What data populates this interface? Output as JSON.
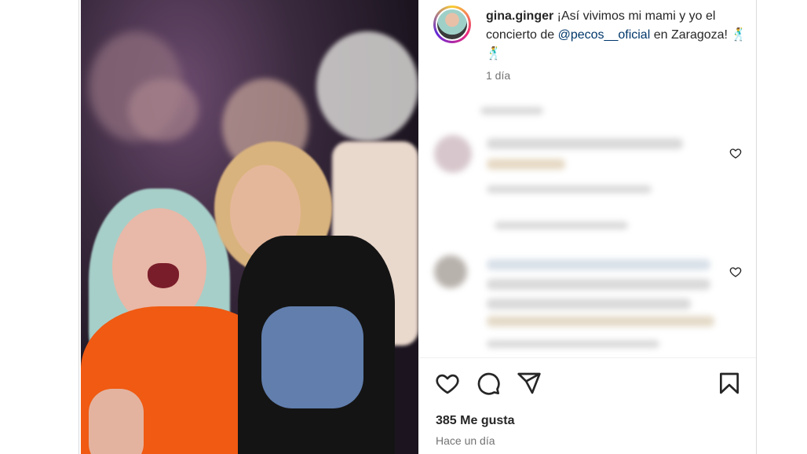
{
  "post": {
    "username": "gina.ginger",
    "caption_pre": " ¡Así vivimos mi mami y yo el concierto de ",
    "mention": "@pecos__oficial",
    "caption_post": " en Zaragoza! 🕺 🕺",
    "time_ago": "1 día"
  },
  "actions": {
    "like_icon": "heart-icon",
    "comment_icon": "comment-icon",
    "share_icon": "share-icon",
    "save_icon": "bookmark-icon"
  },
  "footer": {
    "likes": "385 Me gusta",
    "date": "Hace un día"
  },
  "colors": {
    "mention": "#00376b",
    "muted": "#737373",
    "text": "#262626"
  }
}
